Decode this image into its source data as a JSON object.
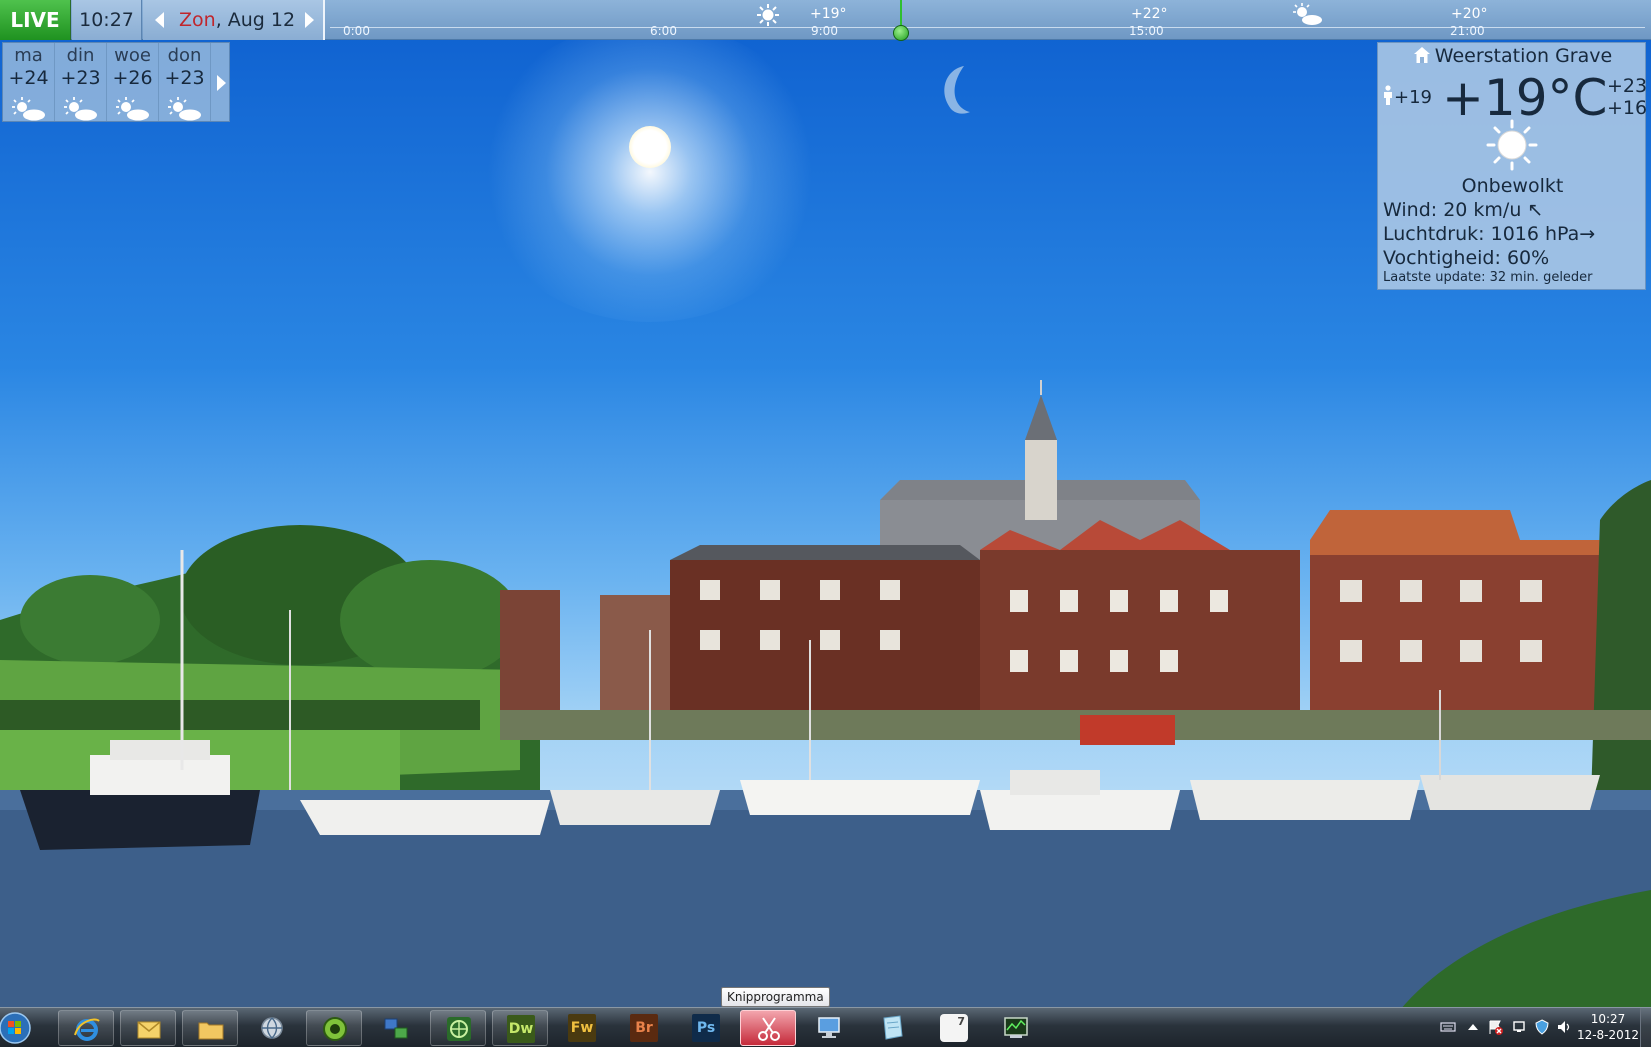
{
  "topbar": {
    "live_label": "LIVE",
    "time": "10:27",
    "day": "Zon",
    "date": ", Aug 12",
    "ticks": [
      "0:00",
      "6:00",
      "9:00",
      "15:00",
      "21:00"
    ],
    "temps": [
      "+19°",
      "+22°",
      "+20°"
    ]
  },
  "forecast": {
    "days": [
      {
        "name": "ma",
        "temp": "+24",
        "icon": "sun-cloud-icon"
      },
      {
        "name": "din",
        "temp": "+23",
        "icon": "sun-cloud-icon"
      },
      {
        "name": "woe",
        "temp": "+26",
        "icon": "sun-cloud-icon"
      },
      {
        "name": "don",
        "temp": "+23",
        "icon": "sun-cloud-icon"
      }
    ]
  },
  "station": {
    "title": "Weerstation Grave",
    "feels_like": "+19",
    "temperature": "+19°C",
    "high": "+23",
    "low": "+16",
    "condition": "Onbewolkt",
    "wind_label": "Wind:",
    "wind_value": "20 km/u",
    "wind_arrow": "↖",
    "pressure_label": "Luchtdruk:",
    "pressure_value": "1016 hPa",
    "pressure_arrow": "→",
    "humidity_label": "Vochtigheid:",
    "humidity_value": "60%",
    "update_label": "Laatste update:",
    "update_value": "32 min. geleder"
  },
  "taskbar": {
    "tooltip": "Knipprogramma",
    "apps": [
      {
        "name": "internet-explorer"
      },
      {
        "name": "outlook"
      },
      {
        "name": "file-explorer"
      },
      {
        "name": "network-browser"
      },
      {
        "name": "green-app"
      },
      {
        "name": "remote-app"
      },
      {
        "name": "globe-app"
      },
      {
        "name": "dreamweaver",
        "label": "Dw",
        "color": "#3a5a1a",
        "text": "#c5e86a"
      },
      {
        "name": "fireworks",
        "label": "Fw",
        "color": "#4a3a10",
        "text": "#f0c040"
      },
      {
        "name": "bridge",
        "label": "Br",
        "color": "#5a2a10",
        "text": "#e8824a"
      },
      {
        "name": "photoshop",
        "label": "Ps",
        "color": "#0f2b4a",
        "text": "#6fb8ef"
      },
      {
        "name": "snipping-tool"
      },
      {
        "name": "remote-desktop"
      },
      {
        "name": "notepad"
      },
      {
        "name": "calendar",
        "label": "7"
      },
      {
        "name": "task-monitor"
      }
    ],
    "clock_time": "10:27",
    "clock_date": "12-8-2012"
  },
  "colors": {
    "live": "#1f9220",
    "day_accent": "#c0262c",
    "now_marker": "#2fbf2f"
  }
}
